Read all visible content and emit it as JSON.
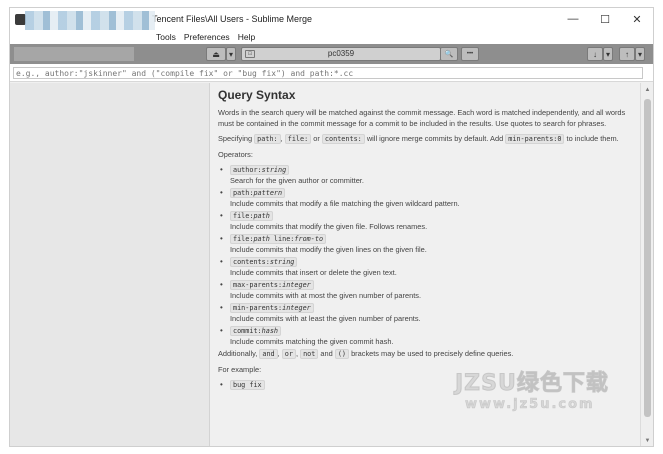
{
  "window": {
    "title": "Tencent Files\\All Users - Sublime Merge",
    "controls": {
      "minimize": "—",
      "maximize": "☐",
      "close": "✕"
    }
  },
  "menu": [
    "Tools",
    "Preferences",
    "Help"
  ],
  "toolbar": {
    "repo_name": "pc0359",
    "stash_icon": "⏏",
    "dropdown_icon": "▾",
    "search_icon": "🔍",
    "more_icon": "•••",
    "pull_icon": "↓",
    "push_icon": "↑"
  },
  "search": {
    "placeholder": "e.g., author:\"jskinner\" and (\"compile fix\" or \"bug fix\") and path:*.cc"
  },
  "help": {
    "title": "Query Syntax",
    "intro": "Words in the search query will be matched against the commit message. Each word is matched independently, and all words must be contained in the commit message for a commit to be included in the results. Use quotes to search for phrases.",
    "specifying_pre": "Specifying",
    "code_path": "path:",
    "code_file": "file:",
    "or_word": "or",
    "code_contents": "contents:",
    "specifying_mid": "will ignore merge commits by default. Add",
    "code_min_parents0": "min-parents:0",
    "specifying_post": "to include them.",
    "operators_label": "Operators:",
    "operators": [
      {
        "key": "author:",
        "arg": "string",
        "desc": "Search for the given author or committer."
      },
      {
        "key": "path:",
        "arg": "pattern",
        "desc": "Include commits that modify a file matching the given wildcard pattern."
      },
      {
        "key": "file:",
        "arg": "path",
        "desc": "Include commits that modify the given file. Follows renames."
      },
      {
        "key": "file:",
        "arg": "path",
        "key2": " line:",
        "arg2": "from-to",
        "desc": "Include commits that modify the given lines on the given file."
      },
      {
        "key": "contents:",
        "arg": "string",
        "desc": "Include commits that insert or delete the given text."
      },
      {
        "key": "max-parents:",
        "arg": "integer",
        "desc": "Include commits with at most the given number of parents."
      },
      {
        "key": "min-parents:",
        "arg": "integer",
        "desc": "Include commits with at least the given number of parents."
      },
      {
        "key": "commit:",
        "arg": "hash",
        "desc": "Include commits matching the given commit hash."
      }
    ],
    "additionally_pre": "Additionally,",
    "code_and": "and",
    "code_or": "or",
    "code_not": "not",
    "and_word": "and",
    "code_parens": "()",
    "additionally_post": "brackets may be used to precisely define queries.",
    "example_label": "For example:",
    "example_first": "bug fix"
  },
  "watermark": {
    "main": "JZSU绿色下载",
    "sub": "www.jz5u.com"
  },
  "colors": {
    "toolbar": "#8e8e8e",
    "left_panel": "#e7e7e7",
    "content_bg": "#f0f0f0",
    "code_bg": "#e4e4e4"
  }
}
